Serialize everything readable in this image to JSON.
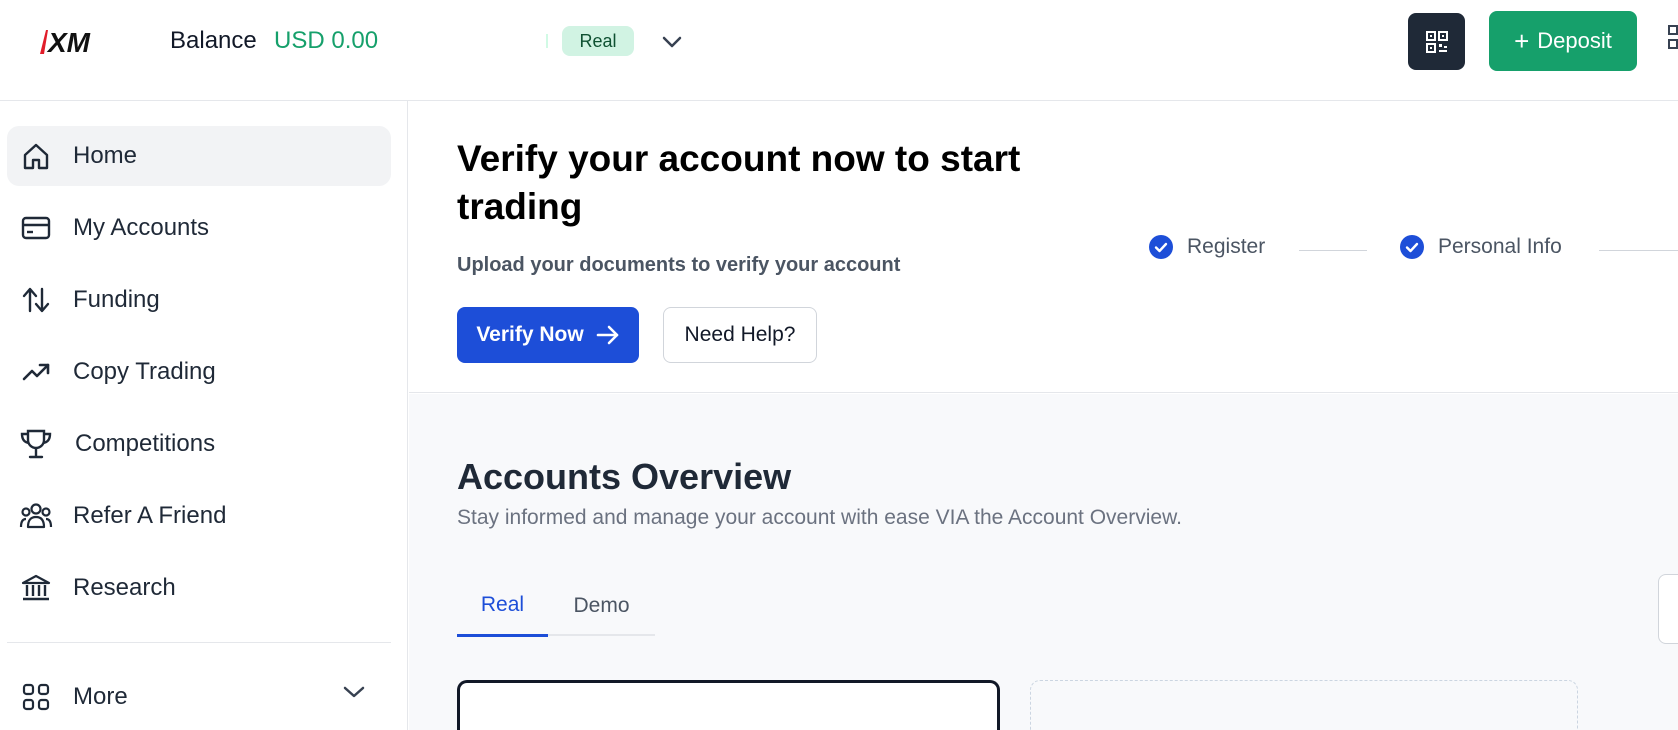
{
  "header": {
    "balance_label": "Balance",
    "balance_value": "USD 0.00",
    "account_type": "Real",
    "deposit_label": "Deposit",
    "brand_color": "#16a06b"
  },
  "sidebar": {
    "items": [
      {
        "label": "Home",
        "icon": "home-icon"
      },
      {
        "label": "My Accounts",
        "icon": "card-icon"
      },
      {
        "label": "Funding",
        "icon": "arrows-updown-icon"
      },
      {
        "label": "Copy Trading",
        "icon": "trend-up-icon"
      },
      {
        "label": "Competitions",
        "icon": "trophy-icon"
      },
      {
        "label": "Refer A Friend",
        "icon": "users-icon"
      },
      {
        "label": "Research",
        "icon": "bank-icon"
      }
    ],
    "more_label": "More"
  },
  "verify": {
    "title": "Verify your account now to start trading",
    "subtitle": "Upload your documents to verify your account",
    "verify_button": "Verify Now",
    "help_button": "Need Help?",
    "steps": [
      "Register",
      "Personal Info"
    ]
  },
  "overview": {
    "title": "Accounts Overview",
    "subtitle": "Stay informed and manage your account with ease VIA the Account Overview.",
    "tabs": [
      "Real",
      "Demo"
    ]
  }
}
